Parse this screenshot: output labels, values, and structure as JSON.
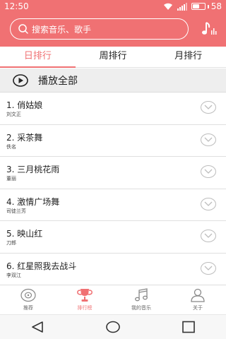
{
  "status_bar": {
    "time": "12:50",
    "battery_text": "58",
    "battery_level": 0.58
  },
  "search": {
    "placeholder": "搜索音乐、歌手"
  },
  "tabs": [
    {
      "label": "日排行",
      "active": true
    },
    {
      "label": "周排行",
      "active": false
    },
    {
      "label": "月排行",
      "active": false
    }
  ],
  "play_all": {
    "label": "播放全部"
  },
  "songs": [
    {
      "title": "1. 俏姑娘",
      "artist": "刘文正"
    },
    {
      "title": "2. 采茶舞",
      "artist": "佚名"
    },
    {
      "title": "3. 三月桃花雨",
      "artist": "董丽"
    },
    {
      "title": "4. 激情广场舞",
      "artist": "司徒兰芳"
    },
    {
      "title": "5. 映山红",
      "artist": "刀郎"
    },
    {
      "title": "6. 红星照我去战斗",
      "artist": "李双江"
    }
  ],
  "bottom_nav": [
    {
      "label": "推荐",
      "icon": "disc-icon",
      "active": false
    },
    {
      "label": "排行榜",
      "icon": "trophy-icon",
      "active": true
    },
    {
      "label": "我的音乐",
      "icon": "music-note-icon",
      "active": false
    },
    {
      "label": "关于",
      "icon": "user-icon",
      "active": false
    }
  ],
  "colors": {
    "accent": "#f07173",
    "divider": "#e0e0e0",
    "play_all_bg": "#eeeeee"
  }
}
